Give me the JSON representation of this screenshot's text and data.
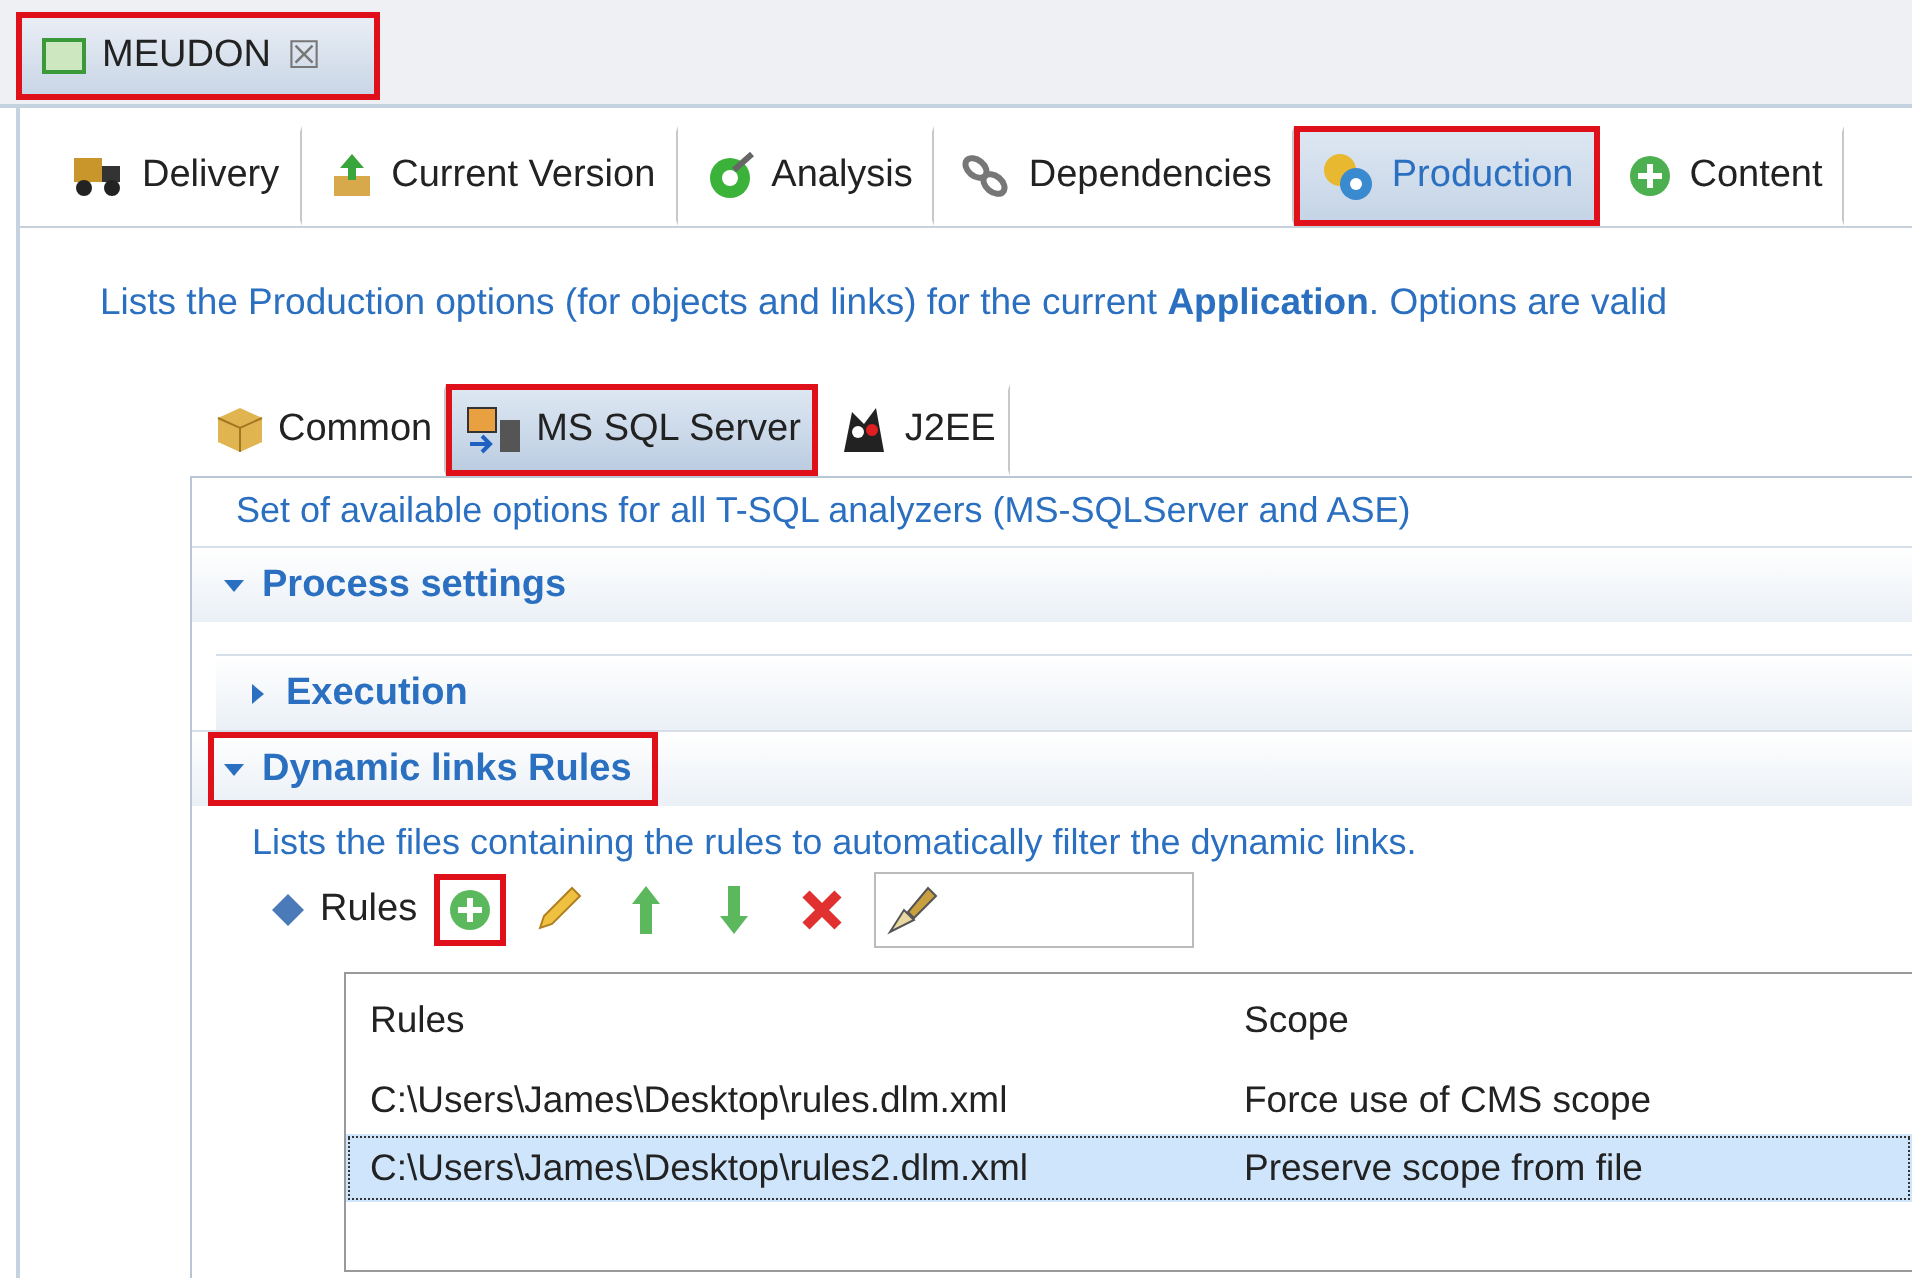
{
  "editor_tab": {
    "title": "MEUDON",
    "close": "☒",
    "highlighted": true
  },
  "main_tabs": [
    {
      "label": "Delivery",
      "selected": false,
      "highlighted": false
    },
    {
      "label": "Current Version",
      "selected": false,
      "highlighted": false
    },
    {
      "label": "Analysis",
      "selected": false,
      "highlighted": false
    },
    {
      "label": "Dependencies",
      "selected": false,
      "highlighted": false
    },
    {
      "label": "Production",
      "selected": true,
      "highlighted": true
    },
    {
      "label": "Content",
      "selected": false,
      "highlighted": false
    }
  ],
  "description": "Lists the Production options (for objects and links) for the current **Application**. Options are valid",
  "sub_tabs": [
    {
      "label": "Common",
      "selected": false,
      "highlighted": false
    },
    {
      "label": "MS SQL Server",
      "selected": true,
      "highlighted": true
    },
    {
      "label": "J2EE",
      "selected": false,
      "highlighted": false
    }
  ],
  "panel_description": "Set of available options for all T-SQL analyzers (MS-SQLServer and ASE)",
  "sections": [
    {
      "title": "Process settings",
      "expanded": true,
      "highlighted": false
    },
    {
      "title": "Execution",
      "expanded": false,
      "highlighted": false
    },
    {
      "title": "Dynamic links Rules",
      "expanded": true,
      "highlighted": true
    }
  ],
  "rules_section": {
    "description": "Lists the files containing the rules to automatically filter the dynamic links.",
    "label": "Rules",
    "toolbar": [
      {
        "kind": "add",
        "highlighted": true
      },
      {
        "kind": "edit",
        "highlighted": false
      },
      {
        "kind": "up",
        "highlighted": false
      },
      {
        "kind": "down",
        "highlighted": false
      },
      {
        "kind": "delete",
        "highlighted": false
      }
    ]
  },
  "table": {
    "columns": [
      "Rules",
      "Scope"
    ],
    "rows": [
      {
        "cells": [
          "C:\\Users\\James\\Desktop\\rules.dlm.xml",
          "Force use of CMS scope"
        ],
        "selected": false
      },
      {
        "cells": [
          "C:\\Users\\James\\Desktop\\rules2.dlm.xml",
          "Preserve scope from file"
        ],
        "selected": true
      }
    ]
  }
}
